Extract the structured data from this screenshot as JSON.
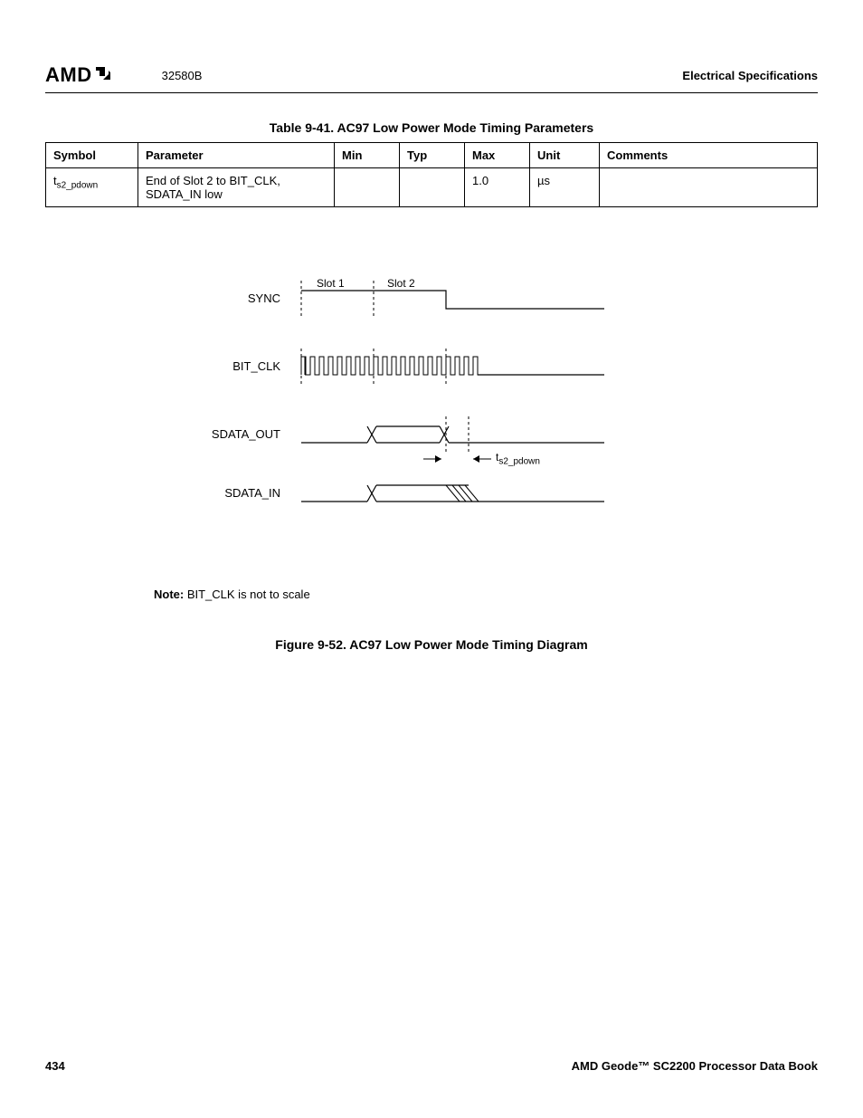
{
  "header": {
    "logo_text": "AMD",
    "doc_number": "32580B",
    "section_title": "Electrical Specifications"
  },
  "table": {
    "title": "Table 9-41.  AC97 Low Power Mode Timing Parameters",
    "headers": [
      "Symbol",
      "Parameter",
      "Min",
      "Typ",
      "Max",
      "Unit",
      "Comments"
    ],
    "rows": [
      {
        "symbol_prefix": "t",
        "symbol_sub": "s2_pdown",
        "parameter": "End of Slot 2 to BIT_CLK, SDATA_IN low",
        "min": "",
        "typ": "",
        "max": "1.0",
        "unit": "µs",
        "comments": ""
      }
    ]
  },
  "diagram": {
    "signals": [
      "SYNC",
      "BIT_CLK",
      "SDATA_OUT",
      "SDATA_IN"
    ],
    "slot_labels": [
      "Slot 1",
      "Slot 2"
    ],
    "measure_prefix": "t",
    "measure_sub": "s2_pdown"
  },
  "note": {
    "label": "Note:",
    "text": " BIT_CLK is not to scale"
  },
  "figure_title": "Figure 9-52.  AC97 Low Power Mode Timing Diagram",
  "footer": {
    "page_number": "434",
    "book_title": "AMD Geode™ SC2200  Processor Data Book"
  }
}
